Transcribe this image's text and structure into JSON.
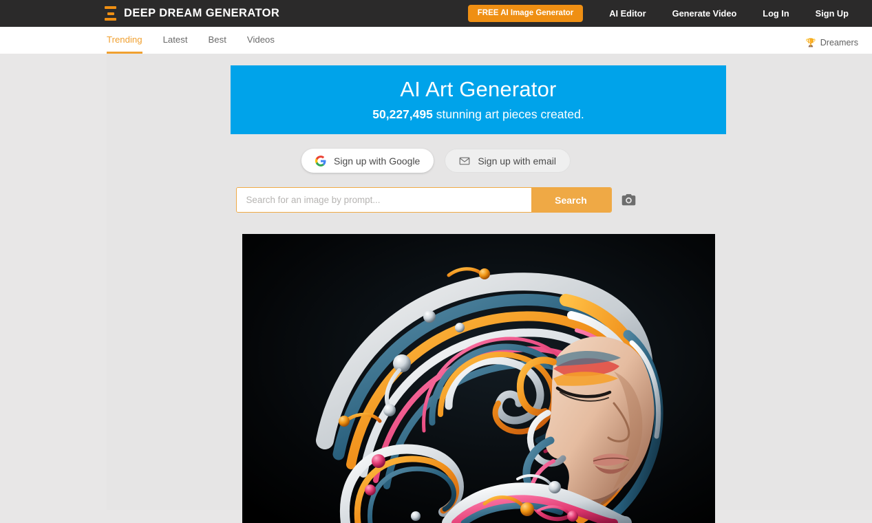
{
  "header": {
    "brand": "DEEP DREAM GENERATOR",
    "brand_icon": "hourglass-logo-icon",
    "cta_label": "FREE AI Image Generator",
    "nav": [
      {
        "label": "AI Editor",
        "name": "ai-editor"
      },
      {
        "label": "Generate Video",
        "name": "generate-video"
      },
      {
        "label": "Log In",
        "name": "log-in"
      },
      {
        "label": "Sign Up",
        "name": "sign-up"
      }
    ]
  },
  "subnav": {
    "tabs": [
      {
        "label": "Trending",
        "active": true
      },
      {
        "label": "Latest",
        "active": false
      },
      {
        "label": "Best",
        "active": false
      },
      {
        "label": "Videos",
        "active": false
      }
    ],
    "dreamers_label": "Dreamers",
    "dreamers_icon": "trophy-icon"
  },
  "hero": {
    "title": "AI Art Generator",
    "count": "50,227,495",
    "subtitle_rest": " stunning art pieces created.",
    "background_color": "#00a3ea"
  },
  "signup": {
    "google_label": "Sign up with Google",
    "google_icon": "google-g-icon",
    "email_label": "Sign up with email",
    "email_icon": "envelope-icon"
  },
  "search": {
    "placeholder": "Search for an image by prompt...",
    "value": "",
    "button_label": "Search",
    "camera_icon": "camera-icon"
  },
  "artwork": {
    "alt": "AI generated portrait of a woman with swirling multicolored liquid hair",
    "background_color": "#000000"
  },
  "colors": {
    "header_bg": "#2b2a2a",
    "accent_orange": "#ef8f13",
    "tab_orange": "#f0a030",
    "search_orange": "#efa945",
    "hero_blue": "#00a3ea",
    "page_bg": "#e8e7e7"
  }
}
